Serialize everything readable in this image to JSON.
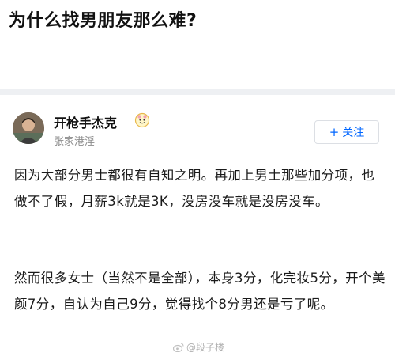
{
  "question": {
    "title": "为什么找男朋友那么难?"
  },
  "answer": {
    "author": {
      "name": "开枪手杰克",
      "location": "张家港淫"
    },
    "follow_button": {
      "plus": "+",
      "label": "关注"
    },
    "paragraphs": [
      "因为大部分男士都很有自知之明。再加上男士那些加分项，也做不了假，月薪3k就是3K，没房没车就是没房没车。",
      "然而很多女士（当然不是全部），本身3分，化完妆5分，开个美颜7分，自认为自己9分，觉得找个8分男还是亏了呢。"
    ]
  },
  "watermark": {
    "text": "@段子楼"
  },
  "colors": {
    "accent": "#0066ff",
    "separator": "#eef0f3",
    "secondary_text": "#8c8c8c"
  }
}
